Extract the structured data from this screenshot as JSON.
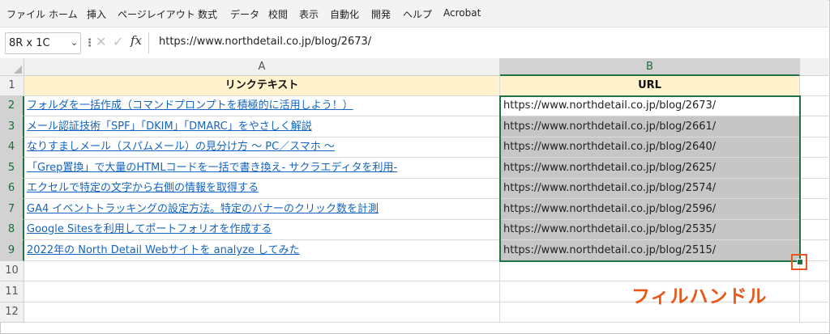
{
  "menu": [
    "ファイル",
    "ホーム",
    "挿入",
    "ページレイアウト",
    "数式",
    "データ",
    "校閲",
    "表示",
    "自動化",
    "開発",
    "ヘルプ",
    "Acrobat"
  ],
  "formula_bar": {
    "name_box": "8R x 1C",
    "name_box_arrow": "⌄",
    "separator": "⋮",
    "cancel": "✕",
    "enter": "✓",
    "fx": "fx",
    "content": "https://www.northdetail.co.jp/blog/2673/"
  },
  "columns": [
    "A",
    "B"
  ],
  "rows": [
    "1",
    "2",
    "3",
    "4",
    "5",
    "6",
    "7",
    "8",
    "9",
    "10",
    "11",
    "12"
  ],
  "table": {
    "headers": [
      "リンクテキスト",
      "URL"
    ],
    "rows": [
      {
        "text": "フォルダを一括作成（コマンドプロンプトを積極的に活用しよう！）",
        "url": "https://www.northdetail.co.jp/blog/2673/"
      },
      {
        "text": "メール認証技術「SPF」「DKIM」「DMARC」をやさしく解説",
        "url": "https://www.northdetail.co.jp/blog/2661/"
      },
      {
        "text": "なりすましメール（スパムメール）の見分け方 〜 PC／スマホ 〜",
        "url": "https://www.northdetail.co.jp/blog/2640/"
      },
      {
        "text": "「Grep置換」で大量のHTMLコードを一括で書き換え- サクラエディタを利用-",
        "url": "https://www.northdetail.co.jp/blog/2625/"
      },
      {
        "text": "エクセルで特定の文字から右側の情報を取得する",
        "url": "https://www.northdetail.co.jp/blog/2574/"
      },
      {
        "text": "GA4 イベントトラッキングの設定方法。特定のバナーのクリック数を計測",
        "url": "https://www.northdetail.co.jp/blog/2596/"
      },
      {
        "text": "Google Sitesを利用してポートフォリオを作成する",
        "url": "https://www.northdetail.co.jp/blog/2535/"
      },
      {
        "text": "2022年の North Detail Webサイトを analyze してみた",
        "url": "https://www.northdetail.co.jp/blog/2515/"
      }
    ]
  },
  "annotation": {
    "label": "フィルハンドル",
    "color": "#e8581c"
  },
  "colors": {
    "header_fill": "#fff2cc",
    "selection": "#217346",
    "link": "#1565c0",
    "selected_fill": "#c6c6c6"
  }
}
